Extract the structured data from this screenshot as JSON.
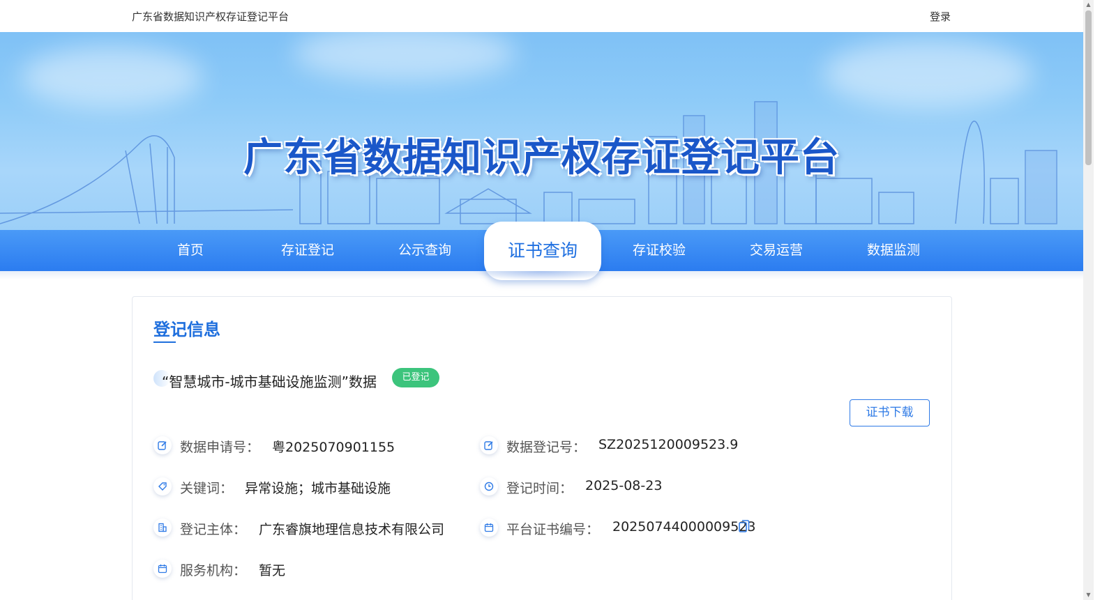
{
  "header": {
    "site_title": "广东省数据知识产权存证登记平台",
    "login_label": "登录"
  },
  "banner": {
    "title": "广东省数据知识产权存证登记平台"
  },
  "nav": {
    "items": [
      {
        "label": "首页",
        "active": false
      },
      {
        "label": "存证登记",
        "active": false
      },
      {
        "label": "公示查询",
        "active": false
      },
      {
        "label": "证书查询",
        "active": true
      },
      {
        "label": "存证校验",
        "active": false
      },
      {
        "label": "交易运营",
        "active": false
      },
      {
        "label": "数据监测",
        "active": false
      }
    ]
  },
  "record": {
    "section_title": "登记信息",
    "data_title": "“智慧城市-城市基础设施监测”数据",
    "status_badge": "已登记",
    "download_label": "证书下载",
    "fields": {
      "application_no": {
        "label": "数据申请号：",
        "value": "粤2025070901155",
        "icon": "edit-icon"
      },
      "registration_no": {
        "label": "数据登记号：",
        "value": "SZ2025120009523.9",
        "icon": "edit-icon"
      },
      "keywords": {
        "label": "关键词：",
        "value": "异常设施；城市基础设施",
        "icon": "tag-icon"
      },
      "registration_time": {
        "label": "登记时间：",
        "value": "2025-08-23",
        "icon": "clock-icon"
      },
      "registrant": {
        "label": "登记主体：",
        "value": "广东睿旗地理信息技术有限公司",
        "icon": "building-icon"
      },
      "certificate_no": {
        "label": "平台证书编号：",
        "value": "20250744000009523",
        "icon": "calendar-icon"
      },
      "service_org": {
        "label": "服务机构：",
        "value": "暂无",
        "icon": "calendar-icon"
      }
    }
  },
  "colors": {
    "accent": "#1f6fdd",
    "nav_bg": "#2b7cf0",
    "badge_green": "#3cc47c"
  }
}
